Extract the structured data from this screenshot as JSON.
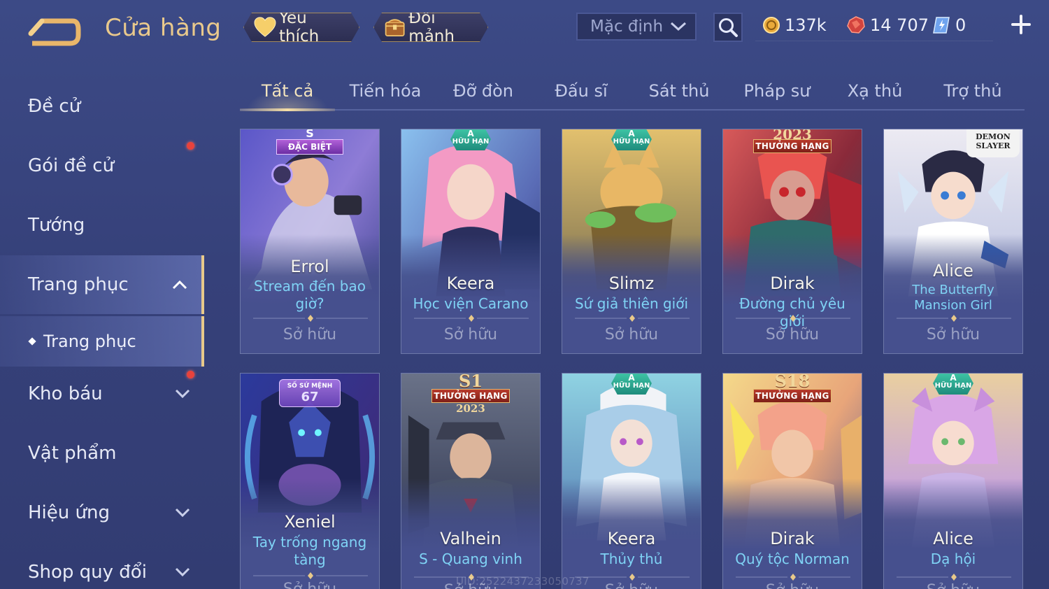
{
  "header": {
    "title": "Cửa hàng",
    "favorites_label": "Yêu thích",
    "exchange_label": "Đổi mảnh",
    "sort_value": "Mặc định",
    "currencies": {
      "gold": "137k",
      "ruby": "14 707",
      "gem": "0"
    }
  },
  "sidebar": {
    "items": [
      {
        "label": "Đề cử"
      },
      {
        "label": "Gói đề cử"
      },
      {
        "label": "Tướng"
      },
      {
        "label": "Trang phục"
      },
      {
        "label": "Trang phục"
      },
      {
        "label": "Kho báu"
      },
      {
        "label": "Vật phẩm"
      },
      {
        "label": "Hiệu ứng"
      },
      {
        "label": "Shop quy đổi"
      }
    ]
  },
  "tabs": [
    "Tất cả",
    "Tiến hóa",
    "Đỡ đòn",
    "Đấu sĩ",
    "Sát thủ",
    "Pháp sư",
    "Xạ thủ",
    "Trợ thủ"
  ],
  "cards": [
    {
      "hero": "Errol",
      "skin": "Stream đến bao giờ?",
      "status": "Sở hữu",
      "badge_top": "S",
      "badge": "ĐẶC BIỆT"
    },
    {
      "hero": "Keera",
      "skin": "Học viện Carano",
      "status": "Sở hữu",
      "badge_top": "A",
      "badge": "HỮU HẠN"
    },
    {
      "hero": "Slimz",
      "skin": "Sứ giả thiên giới",
      "status": "Sở hữu",
      "badge_top": "A",
      "badge": "HỮU HẠN"
    },
    {
      "hero": "Dirak",
      "skin": "Đường chủ yêu giới",
      "status": "Sở hữu",
      "badge_top": "2023",
      "badge": "THƯỞNG HẠNG"
    },
    {
      "hero": "Alice",
      "skin": "The Butterfly Mansion Girl",
      "status": "Sở hữu",
      "badge_top": "DEMON",
      "badge": "SLAYER"
    },
    {
      "hero": "Xeniel",
      "skin": "Tay trống ngang tàng",
      "status": "Sở hữu",
      "badge_top": "SỐ SỨ MỆNH",
      "badge": "67"
    },
    {
      "hero": "Valhein",
      "skin": "S - Quang vinh",
      "status": "Sở hữu",
      "badge_top": "S1",
      "badge": "THƯỞNG HẠNG",
      "badge_year": "2023"
    },
    {
      "hero": "Keera",
      "skin": "Thủy thủ",
      "status": "Sở hữu",
      "badge_top": "A",
      "badge": "HỮU HẠN"
    },
    {
      "hero": "Dirak",
      "skin": "Quý tộc Norman",
      "status": "Sở hữu",
      "badge_top": "S18",
      "badge": "THƯỞNG HẠNG"
    },
    {
      "hero": "Alice",
      "skin": "Dạ hội",
      "status": "Sở hữu",
      "badge_top": "A",
      "badge": "HỮU HẠN"
    }
  ],
  "watermark": "UID:2522437233050737"
}
